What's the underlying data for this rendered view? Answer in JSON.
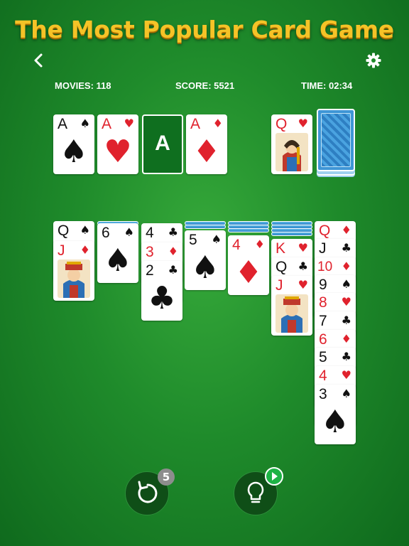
{
  "headline": "The Most Popular Card Game",
  "nav": {
    "back_icon": "chevron-left-icon",
    "settings_icon": "gear-icon"
  },
  "stats": {
    "moves": "MOVIES: 118",
    "score": "SCORE: 5521",
    "time": "TIME: 02:34"
  },
  "foundations": [
    {
      "rank": "A",
      "suit": "♠",
      "color": "black"
    },
    {
      "rank": "A",
      "suit": "♥",
      "color": "red"
    },
    {
      "rank": "A",
      "suit": "",
      "color": "empty"
    },
    {
      "rank": "A",
      "suit": "♦",
      "color": "red"
    }
  ],
  "waste": {
    "rank": "Q",
    "suit": "♥",
    "color": "red",
    "figure": "queen"
  },
  "stock": {
    "label": "stock"
  },
  "tableau": [
    {
      "cards": [
        {
          "rank": "Q",
          "suit": "♠"
        },
        {
          "rank": "J",
          "suit": "♦",
          "figure": "jack"
        }
      ]
    },
    {
      "cards": [
        {
          "rank": "6",
          "suit": "♠"
        }
      ]
    },
    {
      "cards": [
        {
          "rank": "4",
          "suit": "♣"
        },
        {
          "rank": "3",
          "suit": "♦"
        },
        {
          "rank": "2",
          "suit": "♣"
        }
      ]
    },
    {
      "cards": [
        {
          "rank": "5",
          "suit": "♠"
        }
      ]
    },
    {
      "cards": [
        {
          "rank": "4",
          "suit": "♦"
        }
      ]
    },
    {
      "cards": [
        {
          "rank": "K",
          "suit": "♥"
        },
        {
          "rank": "Q",
          "suit": "♣"
        },
        {
          "rank": "J",
          "suit": "♥",
          "figure": "jack"
        }
      ]
    },
    {
      "cards": [
        {
          "rank": "Q",
          "suit": "♦"
        },
        {
          "rank": "J",
          "suit": "♣"
        },
        {
          "rank": "10",
          "suit": "♦"
        },
        {
          "rank": "9",
          "suit": "♠"
        },
        {
          "rank": "8",
          "suit": "♥"
        },
        {
          "rank": "7",
          "suit": "♣"
        },
        {
          "rank": "6",
          "suit": "♦"
        },
        {
          "rank": "5",
          "suit": "♣"
        },
        {
          "rank": "4",
          "suit": "♥"
        },
        {
          "rank": "3",
          "suit": "♠"
        }
      ]
    }
  ],
  "undo": {
    "icon": "undo-icon",
    "badge": "5"
  },
  "hint": {
    "icon": "lightbulb-icon",
    "badge_icon": "play-icon"
  },
  "colors": {
    "felt": "#1f8b2b",
    "headline": "#f5c327",
    "red_suit": "#e0222d",
    "card_back": "#3f96d6"
  }
}
